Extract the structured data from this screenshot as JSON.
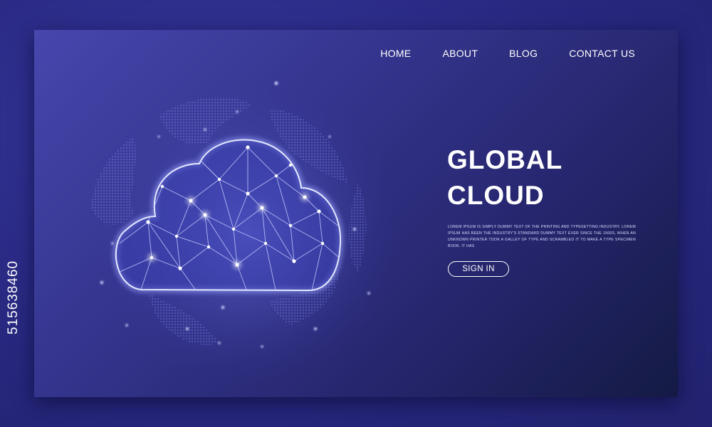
{
  "nav": {
    "items": [
      {
        "label": "HOME"
      },
      {
        "label": "ABOUT"
      },
      {
        "label": "BLOG"
      },
      {
        "label": "CONTACT US"
      }
    ]
  },
  "hero": {
    "title_line1": "GLOBAL",
    "title_line2": "CLOUD",
    "body": "Lorem Ipsum is simply dummy text of the printing and typesetting industry. Lorem Ipsum has been the industry's standard dummy text ever since the 1500s, when an unknown printer took a galley of type and scrambled it to make a type specimen book. It has",
    "signin_label": "SIGN IN"
  },
  "stock_id": "515638460",
  "icons": {
    "hero_art": "cloud-network-globe-icon"
  },
  "colors": {
    "card_start": "#4646ad",
    "card_end": "#141a44",
    "outer_bg": "#2a2a86",
    "text": "#ffffff"
  }
}
